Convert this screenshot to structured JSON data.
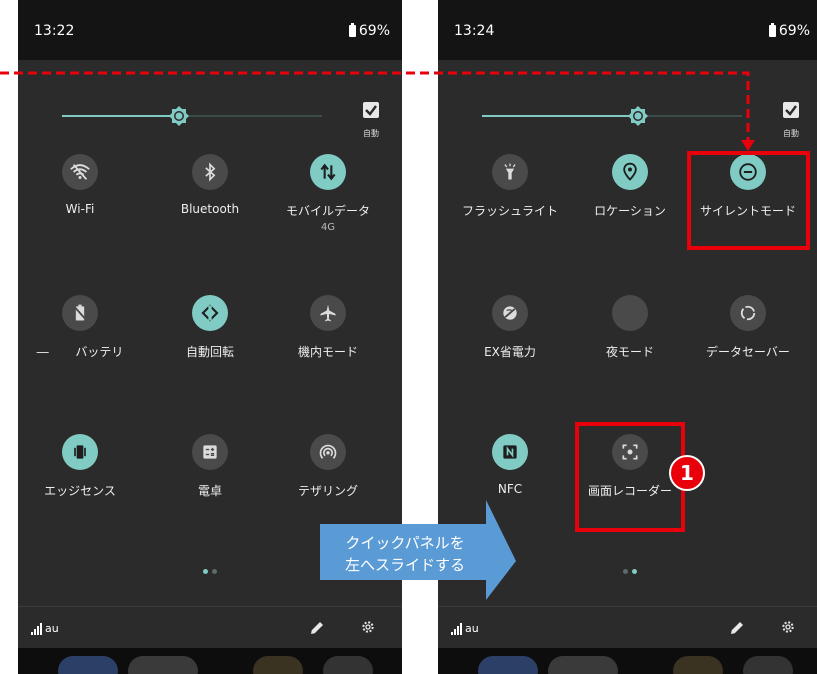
{
  "left_screen": {
    "time": "13:22",
    "battery": "69%",
    "brightness_level": 0.45,
    "auto_brightness_label": "自動",
    "tiles": [
      {
        "label": "Wi-Fi",
        "sublabel": "",
        "icon": "wifi-off-icon",
        "state": "off"
      },
      {
        "label": "Bluetooth",
        "sublabel": "",
        "icon": "bluetooth-icon",
        "state": "off"
      },
      {
        "label": "モバイルデータ",
        "sublabel": "4G",
        "icon": "mobile-data-icon",
        "state": "on"
      },
      {
        "label": "バッテリ",
        "sublabel": "",
        "icon": "battery-saver-icon",
        "state": "off"
      },
      {
        "label": "自動回転",
        "sublabel": "",
        "icon": "auto-rotate-icon",
        "state": "on"
      },
      {
        "label": "機内モード",
        "sublabel": "",
        "icon": "airplane-icon",
        "state": "off"
      },
      {
        "label": "エッジセンス",
        "sublabel": "",
        "icon": "edge-sense-icon",
        "state": "on"
      },
      {
        "label": "電卓",
        "sublabel": "",
        "icon": "calculator-icon",
        "state": "off"
      },
      {
        "label": "テザリング",
        "sublabel": "",
        "icon": "hotspot-icon",
        "state": "off"
      }
    ],
    "page_indicator": {
      "active_index": 0,
      "count": 2
    },
    "carrier": "au"
  },
  "right_screen": {
    "time": "13:24",
    "battery": "69%",
    "brightness_level": 0.6,
    "auto_brightness_label": "自動",
    "tiles": [
      {
        "label": "フラッシュライト",
        "sublabel": "",
        "icon": "flashlight-icon",
        "state": "off"
      },
      {
        "label": "ロケーション",
        "sublabel": "",
        "icon": "location-icon",
        "state": "on"
      },
      {
        "label": "サイレントモード",
        "sublabel": "",
        "icon": "do-not-disturb-icon",
        "state": "on"
      },
      {
        "label": "EX省電力",
        "sublabel": "",
        "icon": "ex-power-saver-icon",
        "state": "off"
      },
      {
        "label": "夜モード",
        "sublabel": "",
        "icon": "night-mode-icon",
        "state": "off"
      },
      {
        "label": "データセーバー",
        "sublabel": "",
        "icon": "data-saver-icon",
        "state": "off"
      },
      {
        "label": "NFC",
        "sublabel": "",
        "icon": "nfc-icon",
        "state": "on"
      },
      {
        "label": "画面レコーダー",
        "sublabel": "",
        "icon": "screen-recorder-icon",
        "state": "off"
      }
    ],
    "page_indicator": {
      "active_index": 1,
      "count": 2
    },
    "carrier": "au"
  },
  "annotations": {
    "callout_line1": "クイックパネルを",
    "callout_line2": "左へスライドする",
    "step_number": "1",
    "highlight_color": "#e8000b",
    "callout_color": "#5b9bd5"
  },
  "colors": {
    "accent": "#80cbc4",
    "tile_off": "#4a4a4a",
    "panel_bg": "#2b2b2b",
    "status_bg": "#141414"
  }
}
